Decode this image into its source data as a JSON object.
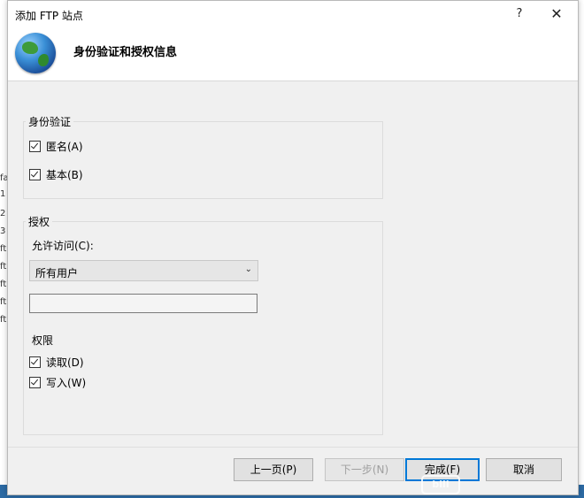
{
  "dialog": {
    "title": "添加 FTP 站点",
    "help": "?",
    "close": "✕",
    "header_title": "身份验证和授权信息"
  },
  "auth": {
    "group_label": "身份验证",
    "anonymous": {
      "label": "匿名(A)",
      "checked": true
    },
    "basic": {
      "label": "基本(B)",
      "checked": true
    }
  },
  "authorization": {
    "group_label": "授权",
    "allow_access_label": "允许访问(C):",
    "allow_access_value": "所有用户",
    "textbox_value": "",
    "permissions_label": "权限",
    "read": {
      "label": "读取(D)",
      "checked": true
    },
    "write": {
      "label": "写入(W)",
      "checked": true
    }
  },
  "buttons": {
    "prev": "上一页(P)",
    "next": "下一步(N)",
    "finish": "完成(F)",
    "cancel": "取消"
  },
  "background": {
    "left_chars": [
      "fa",
      "1",
      "2",
      "3",
      "ft",
      "ft",
      "ft",
      "ft",
      "ft"
    ],
    "watermark_logo": "bili"
  },
  "colors": {
    "accent": "#0078d7",
    "taskbar": "#2c6aa3"
  }
}
